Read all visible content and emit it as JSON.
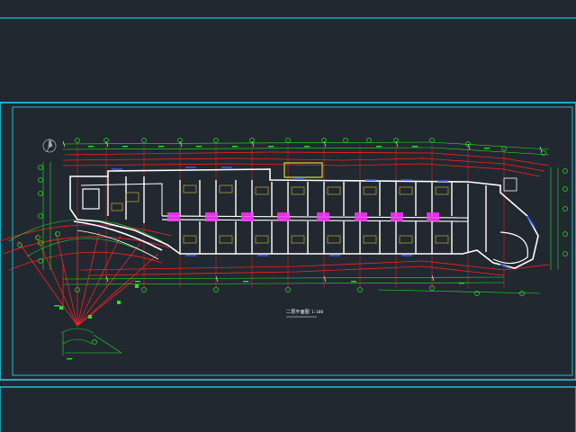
{
  "drawing": {
    "plan_title": "二层平面图",
    "plan_scale": "1:100"
  },
  "colors": {
    "background": "#212830",
    "frame": "#1ee6ff",
    "wall": "#ffffff",
    "axis": "#ff2020",
    "dimension": "#22e622",
    "hatch_magenta": "#ff33ff",
    "furniture": "#e0c040",
    "window": "#3355ff",
    "note": "#ffff33"
  },
  "icons": {
    "north_arrow": "north-arrow-icon"
  }
}
